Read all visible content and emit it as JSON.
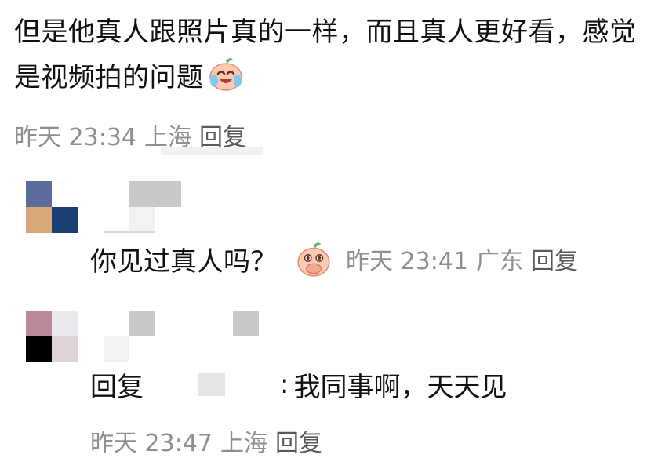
{
  "main_comment": {
    "text": "但是他真人跟照片真的一样，而且真人更好看，感觉是视频拍的问题",
    "emoji": "crying-laughing-peach-emoji",
    "time": "昨天 23:34",
    "location": "上海",
    "reply_label": "回复"
  },
  "reply_1": {
    "text": "你见过真人吗？",
    "emoji": "covering-mouth-peach-emoji",
    "time": "昨天 23:41",
    "location": "广东",
    "reply_label": "回复",
    "avatar_colors": [
      "#5c6b9a",
      "#ffffff",
      "#d7a679",
      "#1c3f73"
    ]
  },
  "reply_2": {
    "prefix": "回复",
    "colon": ":",
    "text": "我同事啊，天天见",
    "time": "昨天 23:47",
    "location": "上海",
    "reply_label": "回复",
    "avatar_colors": [
      "#b88a97",
      "#ebe9ee",
      "#000000",
      "#ddd3d8"
    ]
  }
}
